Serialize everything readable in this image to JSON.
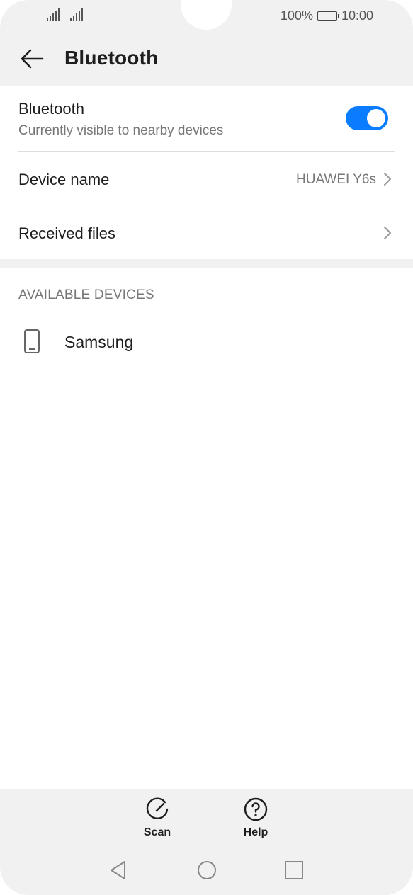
{
  "status_bar": {
    "battery_text": "100%",
    "time": "10:00"
  },
  "header": {
    "title": "Bluetooth",
    "back_icon": "arrow-left-icon"
  },
  "settings": {
    "bluetooth": {
      "label": "Bluetooth",
      "subtitle": "Currently visible to nearby devices",
      "enabled": true
    },
    "device_name": {
      "label": "Device name",
      "value": "HUAWEI Y6s"
    },
    "received_files": {
      "label": "Received files"
    }
  },
  "available_devices": {
    "header": "AVAILABLE DEVICES",
    "items": [
      {
        "name": "Samsung",
        "icon": "phone-icon"
      }
    ]
  },
  "bottom_actions": [
    {
      "label": "Scan",
      "icon": "scan-icon"
    },
    {
      "label": "Help",
      "icon": "help-icon"
    }
  ],
  "nav": [
    "back-nav-icon",
    "home-nav-icon",
    "recents-nav-icon"
  ],
  "colors": {
    "accent": "#0a7cff",
    "background": "#ffffff",
    "bar": "#f1f1f1"
  }
}
